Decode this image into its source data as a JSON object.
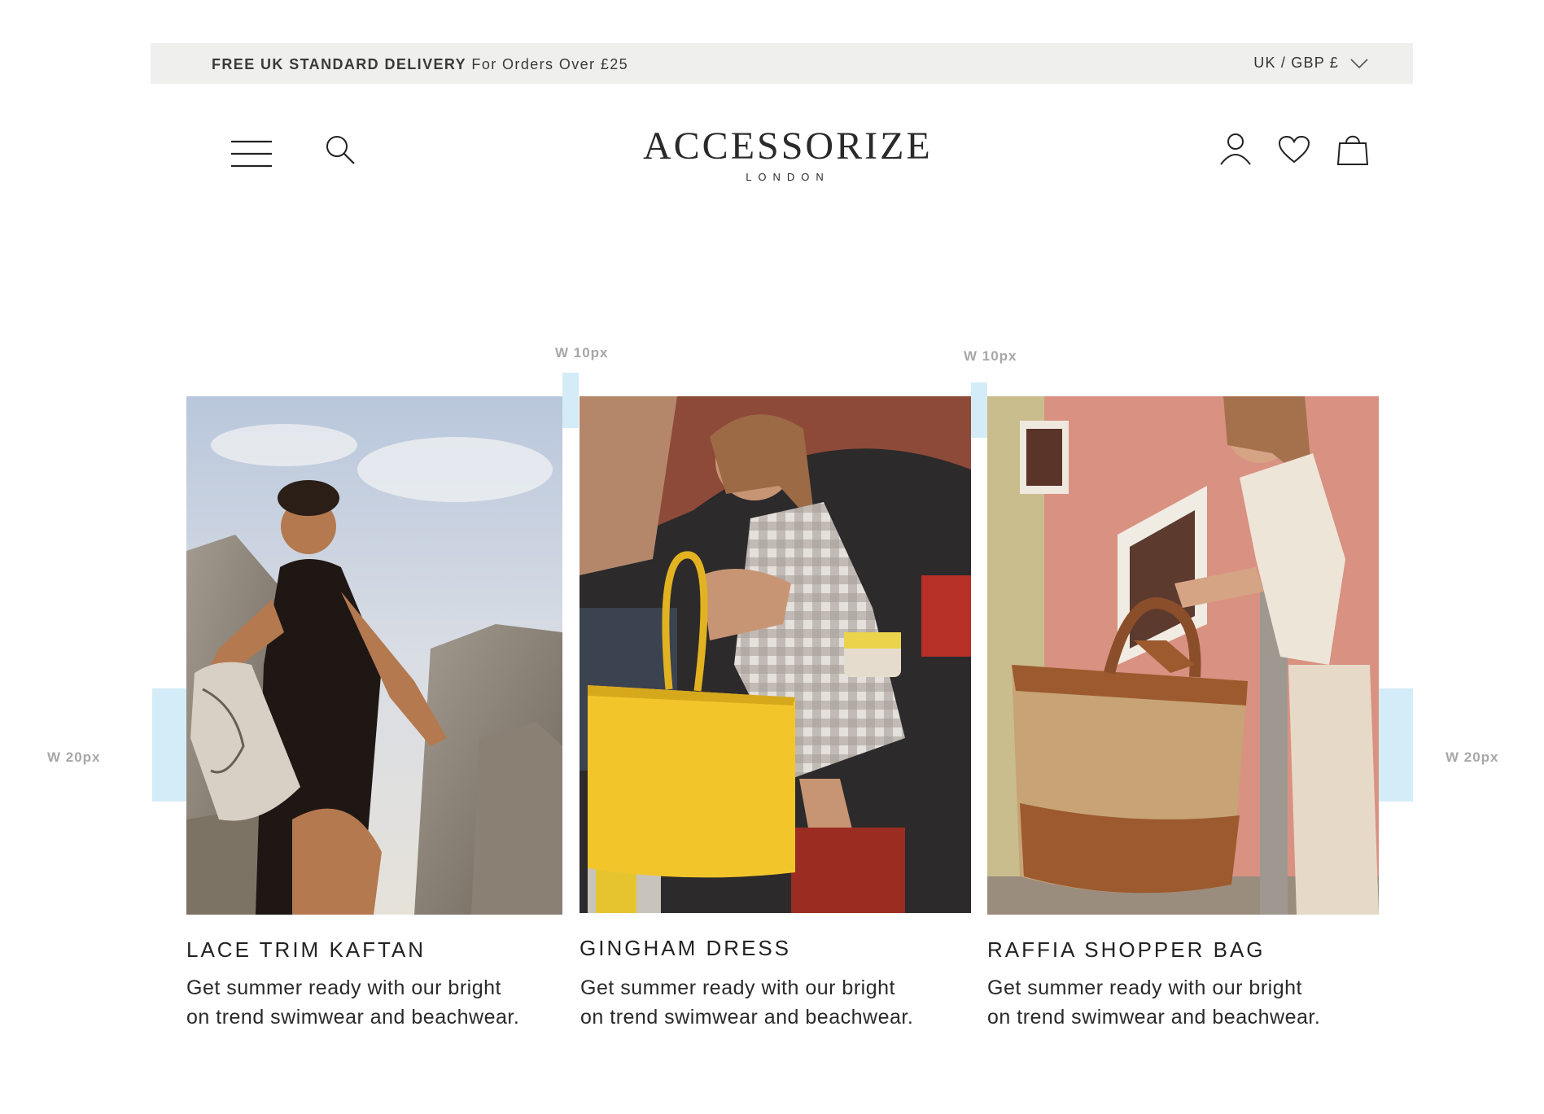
{
  "promo": {
    "bold": "FREE UK STANDARD DELIVERY",
    "rest": "For Orders Over £25",
    "currency": "UK / GBP £"
  },
  "header": {
    "logo_main": "ACCESSORIZE",
    "logo_sub": "LONDON"
  },
  "annotations": {
    "gap_1": "W 10px",
    "gap_2": "W 10px",
    "left_margin": "W 20px",
    "right_margin": "W 20px"
  },
  "cards": [
    {
      "title": "LACE TRIM KAFTAN",
      "desc_line1": "Get summer ready with our bright",
      "desc_line2": "on trend swimwear and beachwear."
    },
    {
      "title": "GINGHAM DRESS",
      "desc_line1": "Get summer ready with our bright",
      "desc_line2": "on trend swimwear and beachwear."
    },
    {
      "title": "RAFFIA SHOPPER BAG",
      "desc_line1": "Get summer ready with our bright",
      "desc_line2": "on trend swimwear and beachwear."
    }
  ],
  "colors": {
    "promo_bg": "#efefee",
    "spacer": "#d4ecf7",
    "annotation_text": "#a7a7a7"
  }
}
